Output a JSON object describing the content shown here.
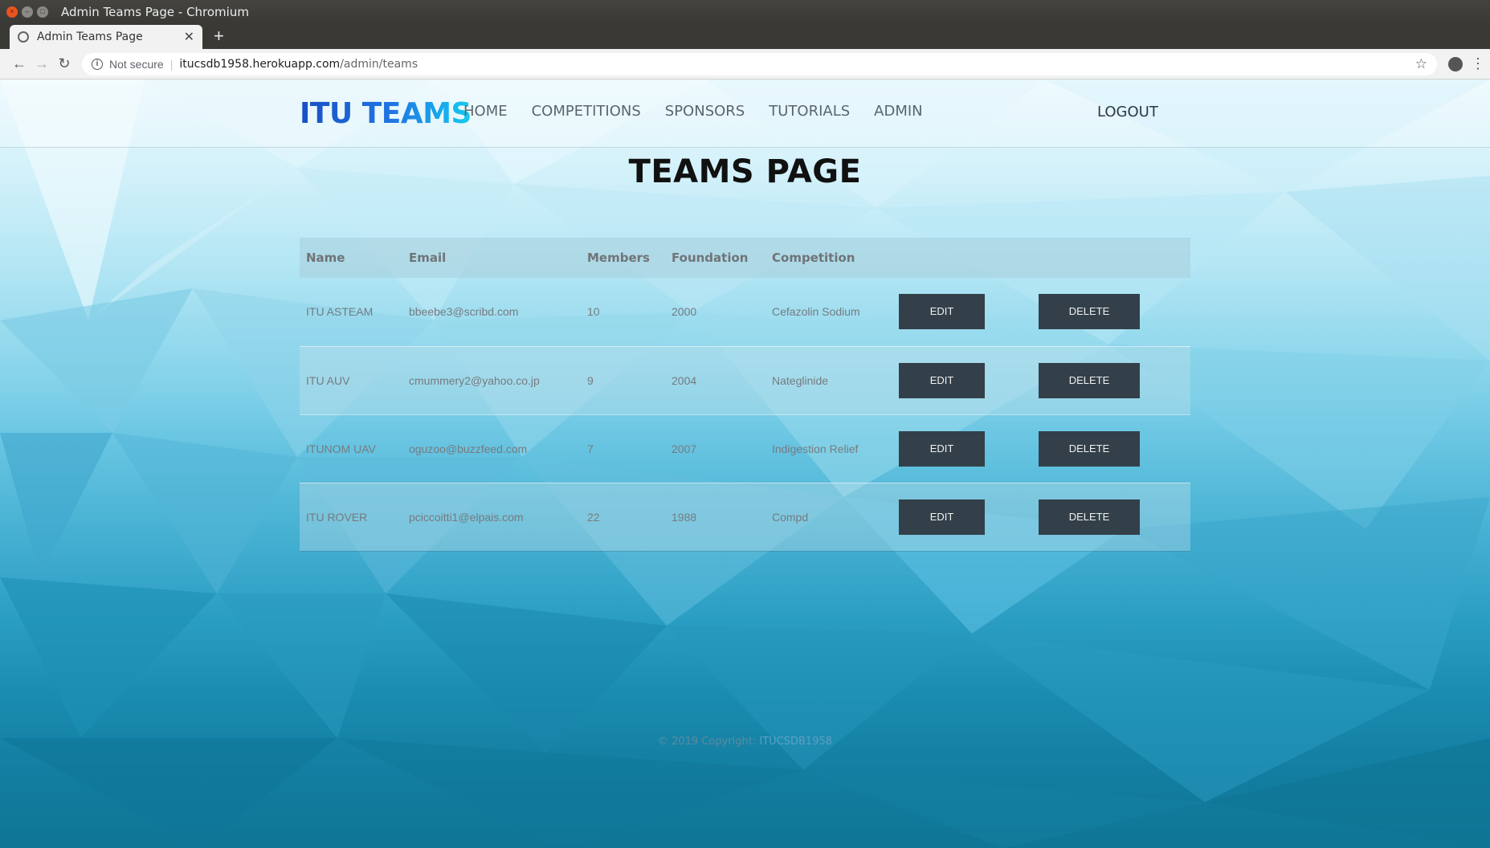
{
  "browser": {
    "window_title": "Admin Teams Page - Chromium",
    "tab_title": "Admin Teams Page",
    "security_label": "Not secure",
    "url_host": "itucsdb1958.herokuapp.com",
    "url_path": "/admin/teams"
  },
  "header": {
    "logo": "ITU TEAMS",
    "nav": [
      "HOME",
      "COMPETITIONS",
      "SPONSORS",
      "TUTORIALS",
      "ADMIN"
    ],
    "logout": "LOGOUT"
  },
  "page": {
    "title": "TEAMS PAGE"
  },
  "table": {
    "columns": [
      "Name",
      "Email",
      "Members",
      "Foundation",
      "Competition"
    ],
    "rows": [
      {
        "name": "ITU ASTEAM",
        "email": "bbeebe3@scribd.com",
        "members": "10",
        "foundation": "2000",
        "competition": "Cefazolin Sodium"
      },
      {
        "name": "ITU AUV",
        "email": "cmummery2@yahoo.co.jp",
        "members": "9",
        "foundation": "2004",
        "competition": "Nateglinide"
      },
      {
        "name": "ITUNOM UAV",
        "email": "oguzoo@buzzfeed.com",
        "members": "7",
        "foundation": "2007",
        "competition": "Indigestion Relief"
      },
      {
        "name": "ITU ROVER",
        "email": "pciccoitti1@elpais.com",
        "members": "22",
        "foundation": "1988",
        "competition": "Compd"
      }
    ],
    "edit_label": "EDIT",
    "delete_label": "DELETE"
  },
  "footer": {
    "copyright": "© 2019 Copyright: ",
    "owner": "ITUCSDB1958"
  },
  "colors": {
    "button_bg": "#33404a",
    "logo_start": "#1a4fc4",
    "logo_end": "#14cbf0"
  }
}
